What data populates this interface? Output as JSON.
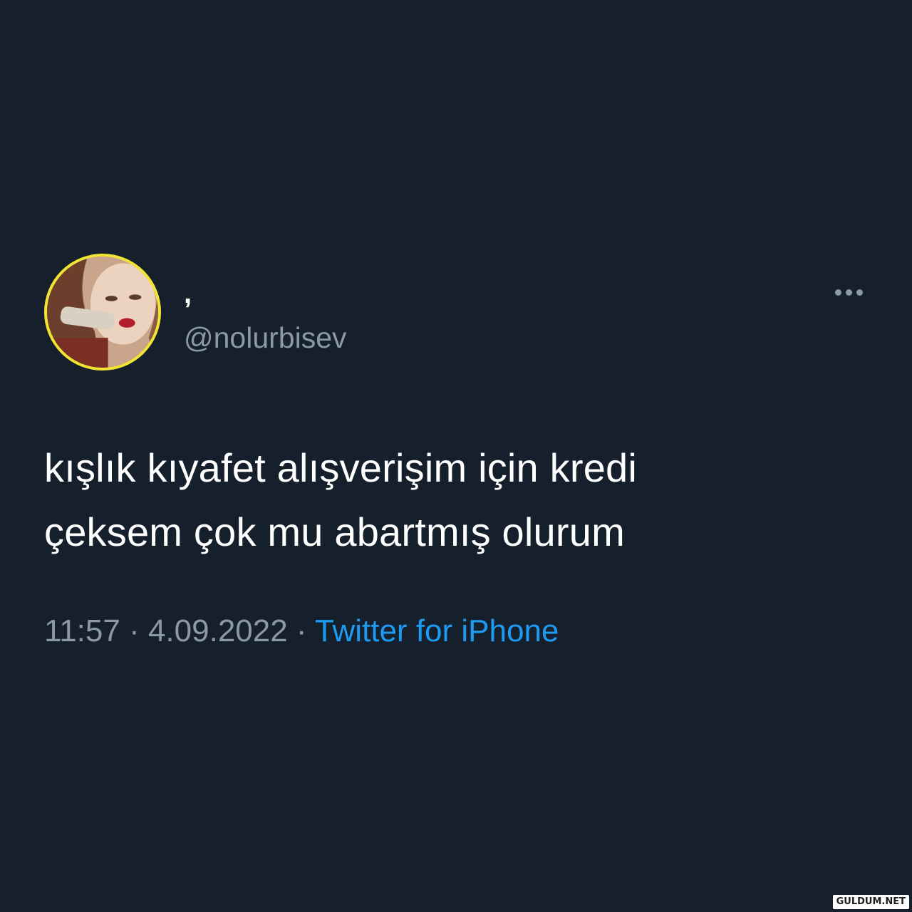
{
  "tweet": {
    "display_name": ",",
    "handle": "@nolurbisev",
    "text_lines": [
      "kışlık kıyafet alışverişim için kredi",
      "çeksem çok mu abartmış olurum"
    ],
    "time": "11:57",
    "separator": " · ",
    "date": "4.09.2022",
    "source": "Twitter for iPhone",
    "more_icon": "more-horizontal-icon"
  },
  "colors": {
    "background": "#161f2c",
    "text_primary": "#ffffff",
    "text_secondary": "#8b98a5",
    "link": "#1d9bf0",
    "avatar_ring": "#f2e531"
  },
  "watermark": "GULDUM.NET"
}
